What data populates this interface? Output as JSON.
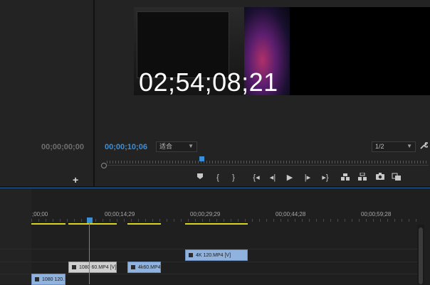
{
  "program": {
    "overlay_timecode": "02;54;08;21",
    "current_timecode": "00;00;10;06",
    "fit_dropdown": "适合",
    "resolution_dropdown": "1/2"
  },
  "source": {
    "timecode": "00;00;00;00",
    "add_label": "+"
  },
  "transport": {
    "marker_icon": "marker-icon",
    "in_label": "{",
    "out_label": "}",
    "go_in_label": "{◂",
    "step_back_label": "◂|",
    "play_label": "▶",
    "step_fwd_label": "|▸",
    "go_out_label": "▸}",
    "lift_icon": "lift-icon",
    "extract_icon": "extract-icon",
    "export_frame_icon": "camera-icon",
    "compare_icon": "compare-icon"
  },
  "timeline": {
    "ruler_labels": [
      ";00;00",
      "00;00;14;29",
      "00;00;29;29",
      "00;00;44;28",
      "00;00;59;28"
    ],
    "clips": {
      "clip_4k120": "4K 120.MP4 [V]",
      "clip_1080_60": "1080 60.MP4 [V]",
      "clip_4k60": "4k60.MP4",
      "clip_1080_120": "1080 120."
    }
  },
  "colors": {
    "accent_blue": "#3a8fd9",
    "render_yellow": "#d9d421",
    "clip_blue": "#8fb2de",
    "clip_gray": "#cfcfcf"
  }
}
